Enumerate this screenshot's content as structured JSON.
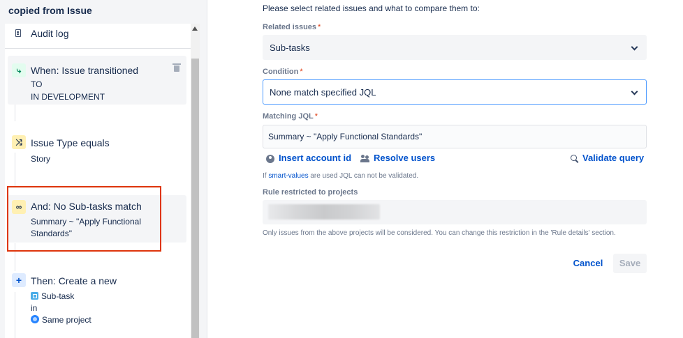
{
  "sidebar": {
    "title": "copied from Issue",
    "audit_log": "Audit log",
    "items": [
      {
        "title": "When: Issue transitioned",
        "line1": "TO",
        "line2": "IN DEVELOPMENT",
        "icon": "branch-icon"
      },
      {
        "title": "Issue Type equals",
        "line1": "Story",
        "icon": "shuffle-icon"
      },
      {
        "title": "And: No Sub-tasks match",
        "line1": "Summary ~ \"Apply Functional",
        "line2": "Standards\"",
        "icon": "link-icon"
      },
      {
        "title": "Then: Create a new",
        "line1": "Sub-task",
        "line2": "in",
        "line3": "Same project",
        "icon": "plus-icon"
      }
    ]
  },
  "form": {
    "intro": "Please select related issues and what to compare them to:",
    "related_issues": {
      "label": "Related issues",
      "value": "Sub-tasks"
    },
    "condition": {
      "label": "Condition",
      "value": "None match specified JQL"
    },
    "matching_jql": {
      "label": "Matching JQL",
      "value": "Summary ~ \"Apply Functional Standards\""
    },
    "links": {
      "insert_account": "Insert account id",
      "resolve_users": "Resolve users",
      "validate_query": "Validate query"
    },
    "helper": {
      "prefix": "If ",
      "smart_values": "smart-values",
      "suffix": " are used JQL can not be validated."
    },
    "restricted": {
      "label": "Rule restricted to projects"
    },
    "restriction_note": "Only issues from the above projects will be considered. You can change this restriction in the 'Rule details' section.",
    "buttons": {
      "cancel": "Cancel",
      "save": "Save"
    }
  },
  "colors": {
    "link": "#0052cc",
    "required": "#de350b",
    "highlight": "#de350b",
    "focus": "#4c9aff"
  }
}
